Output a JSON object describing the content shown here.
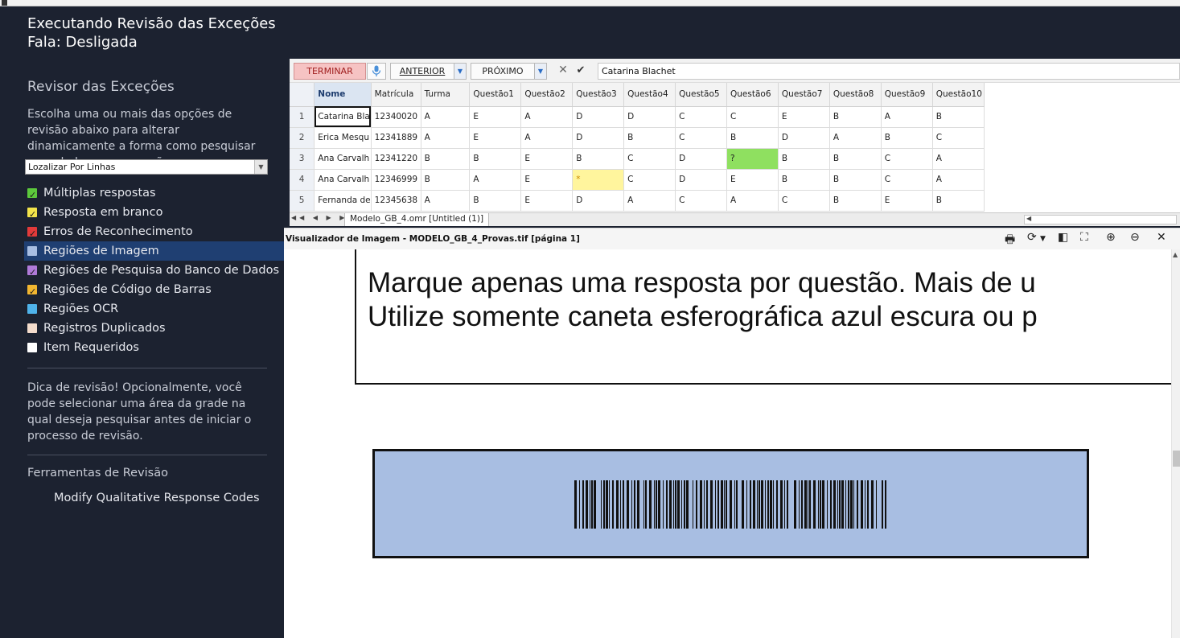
{
  "window": {
    "mode_title": "Executando Revisão das Exceções",
    "speech_status": "Fala: Desligada"
  },
  "panel": {
    "title": "Revisor das Exceções",
    "description": "Escolha uma ou mais das opções de revisão abaixo para alterar dinamicamente a forma como pesquisar seus dados para exceções.",
    "search_mode": "Lozalizar Por Linhas",
    "options": [
      {
        "label": "Múltiplas respostas",
        "color": "#5cc83c",
        "checked": true
      },
      {
        "label": "Resposta em branco",
        "color": "#f2e34a",
        "checked": true
      },
      {
        "label": "Erros de Reconhecimento",
        "color": "#e23a3a",
        "checked": true
      },
      {
        "label": "Regiões de Imagem",
        "color": "#a8bee2",
        "checked": false
      },
      {
        "label": "Regiões de Pesquisa do Banco de Dados",
        "color": "#b07ad8",
        "checked": true
      },
      {
        "label": "Regiões de Código de Barras",
        "color": "#f2b630",
        "checked": true
      },
      {
        "label": "Regiões OCR",
        "color": "#4fb3ea",
        "checked": false
      },
      {
        "label": "Registros Duplicados",
        "color": "#f3dccc",
        "checked": false
      },
      {
        "label": "Item Requeridos",
        "color": "#ffffff",
        "checked": false
      }
    ],
    "tip": "Dica de revisão! Opcionalmente, você pode selecionar uma área da grade na qual deseja pesquisar antes de iniciar o processo de revisão.",
    "tools_title": "Ferramentas de Revisão",
    "tools_item": "Modify Qualitative Response Codes"
  },
  "toolbar": {
    "terminar": "TERMINAR",
    "anterior": "ANTERIOR",
    "proximo": "PRÓXIMO",
    "cell_value": "Catarina Blachet"
  },
  "grid": {
    "columns": [
      "Nome",
      "Matrícula",
      "Turma",
      "Questão1",
      "Questão2",
      "Questão3",
      "Questão4",
      "Questão5",
      "Questão6",
      "Questão7",
      "Questão8",
      "Questão9",
      "Questão10"
    ],
    "rows": [
      {
        "n": "1",
        "cells": [
          "Catarina Bla",
          "12340020",
          "A",
          "E",
          "A",
          "D",
          "D",
          "C",
          "C",
          "E",
          "B",
          "A",
          "B"
        ]
      },
      {
        "n": "2",
        "cells": [
          "Erica Mesqu",
          "12341889",
          "A",
          "E",
          "A",
          "D",
          "B",
          "C",
          "B",
          "D",
          "A",
          "B",
          "C"
        ]
      },
      {
        "n": "3",
        "cells": [
          "Ana Carvalh",
          "12341220",
          "B",
          "B",
          "E",
          "B",
          "C",
          "D",
          "?",
          "B",
          "B",
          "C",
          "A"
        ]
      },
      {
        "n": "4",
        "cells": [
          "Ana Carvalh",
          "12346999",
          "B",
          "A",
          "E",
          "*",
          "C",
          "D",
          "E",
          "B",
          "B",
          "C",
          "A"
        ]
      },
      {
        "n": "5",
        "cells": [
          "Fernanda de",
          "12345638",
          "A",
          "B",
          "E",
          "D",
          "A",
          "C",
          "A",
          "C",
          "B",
          "E",
          "B"
        ]
      }
    ],
    "sheet_tab": "Modelo_GB_4.omr [Untitled (1)]"
  },
  "viewer": {
    "title": "Visualizador de Imagem - MODELO_GB_4_Provas.tif  [página 1]",
    "line1": "Marque apenas uma resposta por questão. Mais de u",
    "line2": "Utilize somente caneta esferográfica azul escura ou p"
  }
}
